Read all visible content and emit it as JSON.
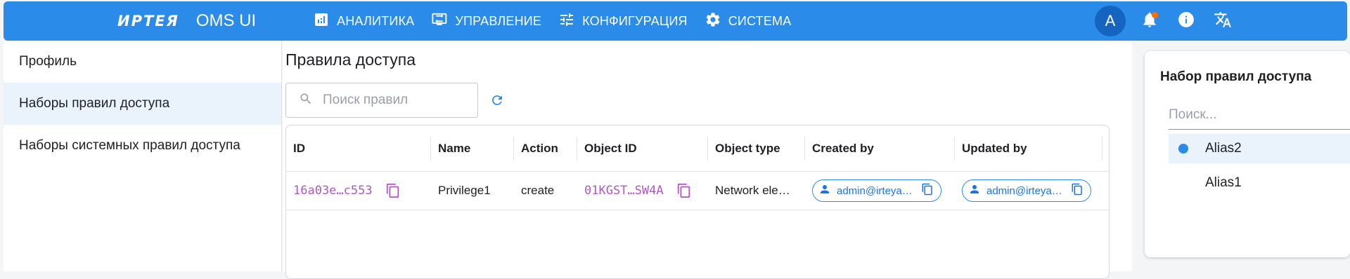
{
  "brand": {
    "logo": "ИРТЕЯ",
    "app": "OMS UI"
  },
  "nav": [
    {
      "label": "АНАЛИТИКА",
      "icon": "analytics-icon"
    },
    {
      "label": "УПРАВЛЕНИЕ",
      "icon": "management-icon"
    },
    {
      "label": "КОНФИГУРАЦИЯ",
      "icon": "tune-icon"
    },
    {
      "label": "СИСТЕМА",
      "icon": "gear-icon"
    }
  ],
  "user": {
    "avatar_letter": "A"
  },
  "colors": {
    "primary": "#2a8be8",
    "accent_mono": "#b455c8",
    "notification": "#ff6d00",
    "avatar": "#1565c0"
  },
  "sidebar": {
    "items": [
      {
        "label": "Профиль"
      },
      {
        "label": "Наборы правил доступа"
      },
      {
        "label": "Наборы системных правил доступа"
      }
    ]
  },
  "main": {
    "title": "Правила доступа",
    "search_placeholder": "Поиск правил",
    "table": {
      "columns": [
        "ID",
        "Name",
        "Action",
        "Object ID",
        "Object type",
        "Created by",
        "Updated by"
      ],
      "rows": [
        {
          "id": "16a03e…c553",
          "name": "Privilege1",
          "action": "create",
          "object_id": "01KGST…SW4A",
          "object_type": "Network ele…",
          "created_by": "admin@irteya…",
          "updated_by": "admin@irteya…"
        }
      ]
    }
  },
  "rightpanel": {
    "title": "Набор правил доступа",
    "search_placeholder": "Поиск...",
    "items": [
      {
        "label": "Alias2",
        "selected": true
      },
      {
        "label": "Alias1",
        "selected": false
      }
    ]
  }
}
